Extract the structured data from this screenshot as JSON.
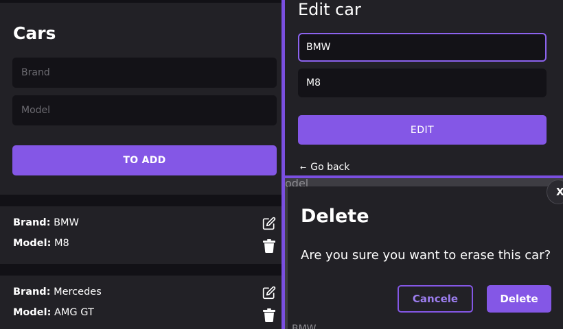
{
  "colors": {
    "accent": "#8457e6",
    "background": "#121116",
    "card": "#222126",
    "input": "#131217"
  },
  "cars_panel": {
    "title": "Cars",
    "brand_placeholder": "Brand",
    "model_placeholder": "Model",
    "add_label": "TO ADD"
  },
  "car_list": [
    {
      "brand_label": "Brand:",
      "brand": "BMW",
      "model_label": "Model:",
      "model": "M8",
      "edit_icon": "edit-icon",
      "delete_icon": "trash-icon"
    },
    {
      "brand_label": "Brand:",
      "brand": "Mercedes",
      "model_label": "Model:",
      "model": "AMG GT",
      "edit_icon": "edit-icon",
      "delete_icon": "trash-icon"
    }
  ],
  "edit_panel": {
    "title": "Edit car",
    "brand_value": "BMW",
    "model_value": "M8",
    "edit_label": "EDIT",
    "go_back_arrow": "←",
    "go_back_label": "Go back"
  },
  "background_text": {
    "model_fragment": "odel",
    "bmw_fragment": "BMW"
  },
  "delete_dialog": {
    "close_label": "X",
    "title": "Delete",
    "message": "Are you sure you want to erase this car?",
    "cancel_label": "Cancele",
    "delete_label": "Delete"
  }
}
